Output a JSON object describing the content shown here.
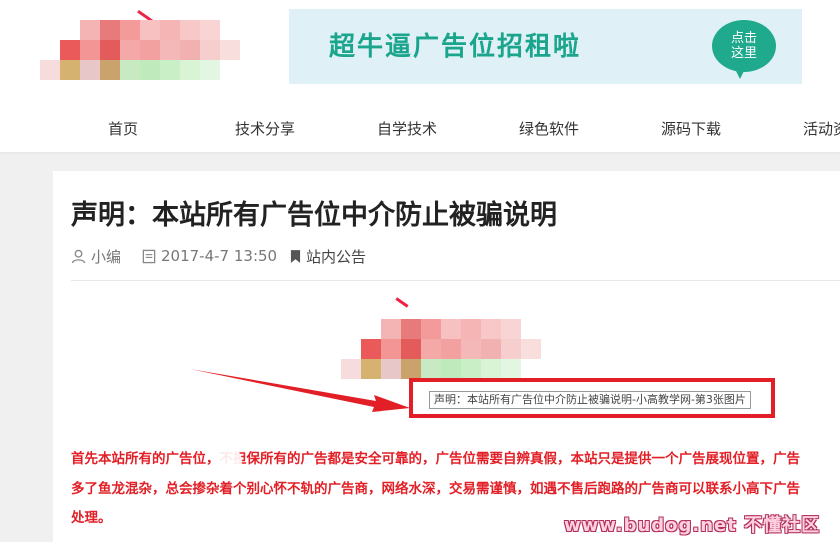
{
  "ad": {
    "text": "超牛逼广告位招租啦",
    "bubble_line1": "点击",
    "bubble_line2": "这里",
    "color": "#1fa98d"
  },
  "nav": {
    "items": [
      {
        "label": "首页"
      },
      {
        "label": "技术分享"
      },
      {
        "label": "自学技术"
      },
      {
        "label": "绿色软件"
      },
      {
        "label": "源码下载"
      },
      {
        "label": "活动资"
      }
    ]
  },
  "article": {
    "title": "声明：本站所有广告位中介防止被骗说明",
    "author": "小编",
    "date": "2017-4-7 13:50",
    "category": "站内公告",
    "image_caption": "声明：本站所有广告位中介防止被骗说明-小高教学网-第3张图片",
    "body": "首先本站所有的广告位，不担保所有的广告都是安全可靠的，广告位需要自辨真假，本站只是提供一个广告展现位置，广告多了鱼龙混杂，总会掺杂着个别心怀不轨的广告商，网络水深，交易需谨慎，如遇不售后跑路的广告商可以联系小高下广告处理。",
    "highlight_color": "#e21f26"
  },
  "watermark": {
    "text": "www.budog.net 不懂社区"
  },
  "icons": {
    "author": "user-icon",
    "date": "calendar-icon",
    "category": "bookmark-icon"
  }
}
